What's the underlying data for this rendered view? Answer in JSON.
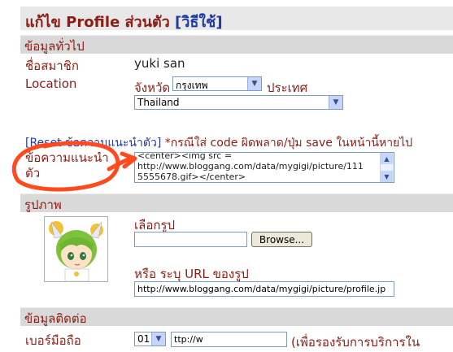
{
  "page": {
    "title": "แก้ไข Profile ส่วนตัว",
    "help_link": "[วิธีใช้]"
  },
  "general": {
    "section_title": "ข้อมูลทั่วไป",
    "member_label": "ชื่อสมาชิก",
    "member_value": "yuki san",
    "location_label": "Location",
    "province_label": "จังหวัด",
    "province_value": "กรุงเทพ",
    "country_label": "ประเทศ",
    "country_value": "Thailand",
    "reset_link": "[Reset ข้อความแนะนำตัว]",
    "reset_note": "*กรณีใส่ code ผิดพลาด/ปุ่ม save ในหน้านี้หายไป",
    "intro_label_line1": "ข้อความแนะนำ",
    "intro_label_line2": "ตัว",
    "intro_value_line1": "<center><img src =",
    "intro_value_line2": "http://www.bloggang.com/data/mygigi/picture/111",
    "intro_value_line3": "5555678.gif></center>"
  },
  "picture": {
    "section_title": "รูปภาพ",
    "choose_label": "เลือกรูป",
    "file_value": "",
    "browse_label": "Browse...",
    "url_label": "หรือ ระบุ URL ของรูป",
    "url_value": "http://www.bloggang.com/data/mygigi/picture/profile.jp"
  },
  "contact": {
    "section_title": "ข้อมูลติดต่อ",
    "mobile_label": "เบอร์มือถือ",
    "prefix_value": "01",
    "number_value": "ttp://w",
    "mobile_note": "(เพื่อรองรับการบริการใน"
  },
  "icons": {
    "dropdown": "chevron-down-icon",
    "scroll_up": "triangle-up-icon",
    "scroll_down": "triangle-down-icon",
    "avatar": "anime-avatar-image",
    "annotation": "red-circle-arrow"
  },
  "colors": {
    "label_red": "#8b1d14",
    "link_blue": "#1f3aa3",
    "section_bg": "#d9d9d9",
    "annotation": "#ff4a1f"
  }
}
